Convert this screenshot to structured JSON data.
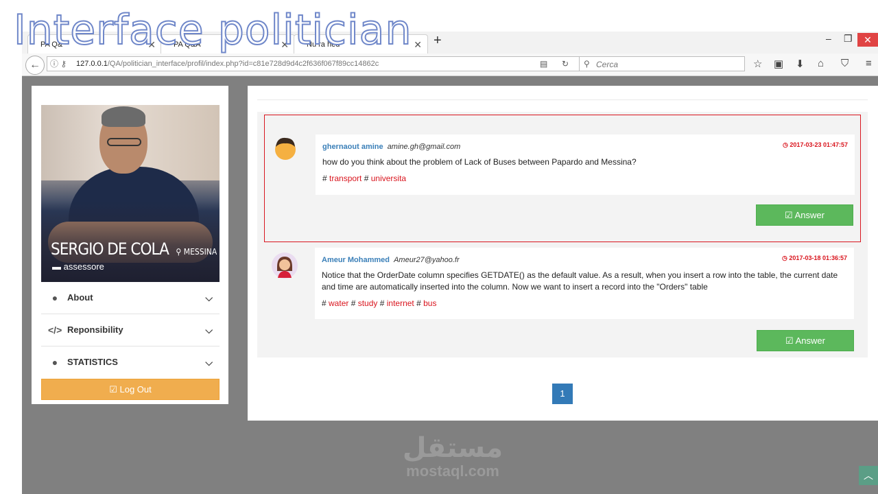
{
  "slide": {
    "title": "Interface politician"
  },
  "browser": {
    "tabs": [
      {
        "label": "PA Q&",
        "close": "✕"
      },
      {
        "label": "PA Q&A",
        "close": "✕"
      },
      {
        "label": "Nu   ra  hed",
        "close": "✕"
      }
    ],
    "new_tab": "+",
    "url_host": "127.0.0.1",
    "url_path": "/QA/politician_interface/profil/index.php?id=c81e728d9d4c2f636f067f89cc14862c",
    "search_placeholder": "Cerca"
  },
  "profile": {
    "name": "SERGIO DE COLA",
    "city": "MESSINA",
    "role": "assessore",
    "menu": [
      {
        "label": "About"
      },
      {
        "label": "Reponsibility"
      },
      {
        "label": "STATISTICS"
      }
    ],
    "logout_label": "Log Out"
  },
  "questions": [
    {
      "author": "ghernaout amine",
      "email": "amine.gh@gmail.com",
      "date": "2017-03-23 01:47:57",
      "text": "how do you think about the problem of Lack of Buses between Papardo and Messina?",
      "tags": [
        "transport",
        "universita"
      ],
      "answer_label": "Answer"
    },
    {
      "author": "Ameur Mohammed",
      "email": "Ameur27@yahoo.fr",
      "date": "2017-03-18 01:36:57",
      "text": "Notice that the OrderDate column specifies GETDATE() as the default value. As a result, when you insert a row into the table, the current date and time are automatically inserted into the column. Now we want to insert a record into the \"Orders\" table",
      "tags": [
        "water",
        "study",
        "internet",
        "bus"
      ],
      "answer_label": "Answer"
    }
  ],
  "pagination": {
    "current": "1"
  },
  "watermark": {
    "arabic": "مستقل",
    "latin": "mostaql.com"
  }
}
